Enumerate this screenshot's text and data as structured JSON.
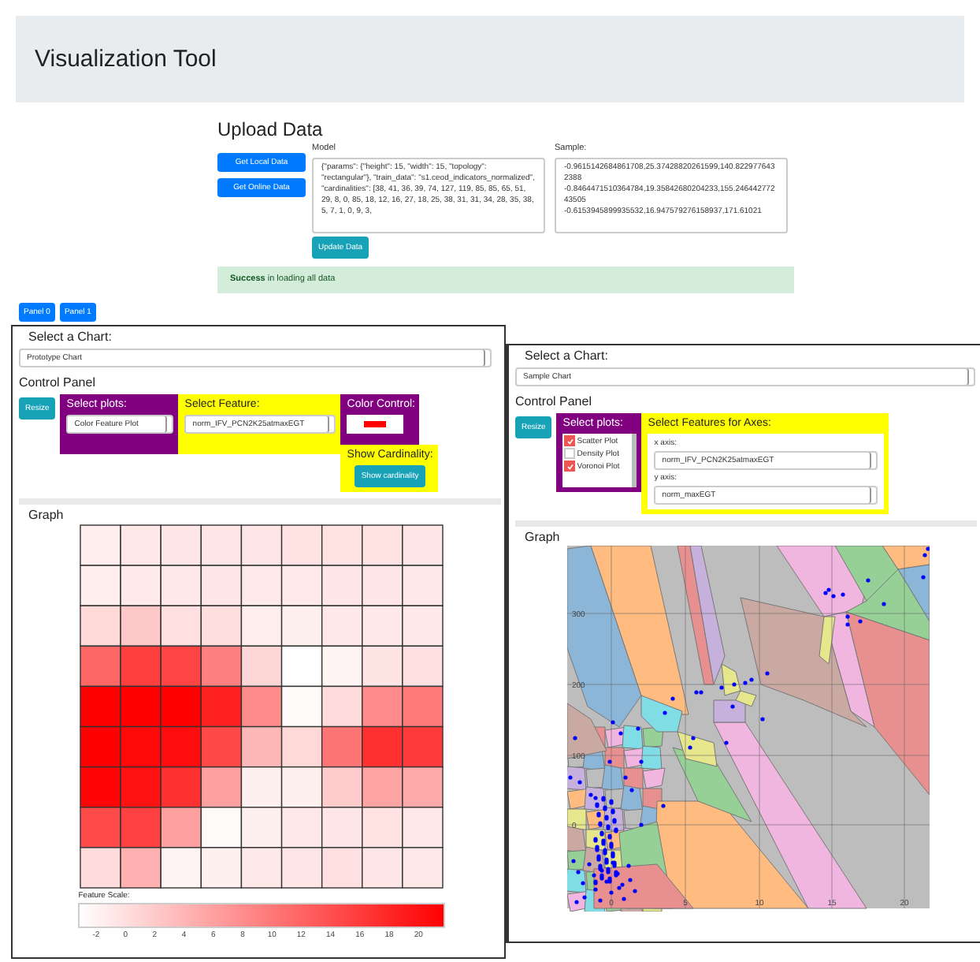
{
  "header": {
    "title": "Visualization Tool"
  },
  "upload": {
    "title": "Upload Data",
    "buttons": [
      "Get Local Data",
      "Get Online Data"
    ],
    "model": {
      "label": "Model",
      "value": "{\"params\": {\"height\": 15, \"width\": 15, \"topology\": \"rectangular\"}, \"train_data\": \"s1.ceod_indicators_normalized\", \"cardinalities\": [38, 41, 36, 39, 74, 127, 119, 85, 85, 65, 51, 29, 8, 0, 85, 18, 12, 16, 27, 18, 25, 38, 31, 31, 34, 28, 35, 38, 5, 7, 1, 0, 9, 3,"
    },
    "sample": {
      "label": "Sample:",
      "value": "-0.9615142684861708,25.37428820261599,140.8229776432388\n-0.8464471510364784,19.35842680204233,155.24644277243505\n-0.6153945899935532,16.947579276158937,171.61021"
    },
    "update_button": "Update Data",
    "alert": "**Success** in loading all data"
  },
  "panel_tabs": [
    "Panel 0",
    "Panel 1"
  ],
  "panels": [
    {
      "kind": "prototype",
      "chart_label": "Select a Chart:",
      "chart": "Prototype Chart",
      "control_title": "Control Panel",
      "resize": "Resize",
      "select_plots": {
        "label": "Select plots:",
        "value": "Color Feature Plot"
      },
      "select_feature": {
        "label": "Select Feature:",
        "value": "norm_IFV_PCN2K25atmaxEGT"
      },
      "color_control": {
        "label": "Color Control:",
        "color": "#ff0000"
      },
      "cardinality": {
        "label": "Show Cardinality:",
        "button": "Show cardinality"
      },
      "graph_title": "Graph",
      "scale": {
        "label": "Feature Scale:",
        "ticks": [
          "-2",
          "0",
          "2",
          "4",
          "6",
          "8",
          "10",
          "12",
          "14",
          "16",
          "18",
          "20"
        ]
      }
    },
    {
      "kind": "sample",
      "chart_label": "Select a Chart:",
      "chart": "Sample Chart",
      "control_title": "Control Panel",
      "resize": "Resize",
      "plots": {
        "label": "Select plots:",
        "items": [
          {
            "label": "Scatter Plot",
            "checked": true
          },
          {
            "label": "Density Plot",
            "checked": false
          },
          {
            "label": "Voronoi Plot",
            "checked": true
          }
        ]
      },
      "axes": {
        "label": "Select Features for Axes:",
        "x_label": "x axis:",
        "x_value": "norm_IFV_PCN2K25atmaxEGT",
        "y_label": "y axis:",
        "y_value": "norm_maxEGT"
      },
      "graph_title": "Graph",
      "plot": {
        "xticks": [
          "0",
          "5",
          "10",
          "15",
          "20"
        ],
        "yticks": [
          "300",
          "200",
          "100",
          "0"
        ]
      }
    }
  ]
}
